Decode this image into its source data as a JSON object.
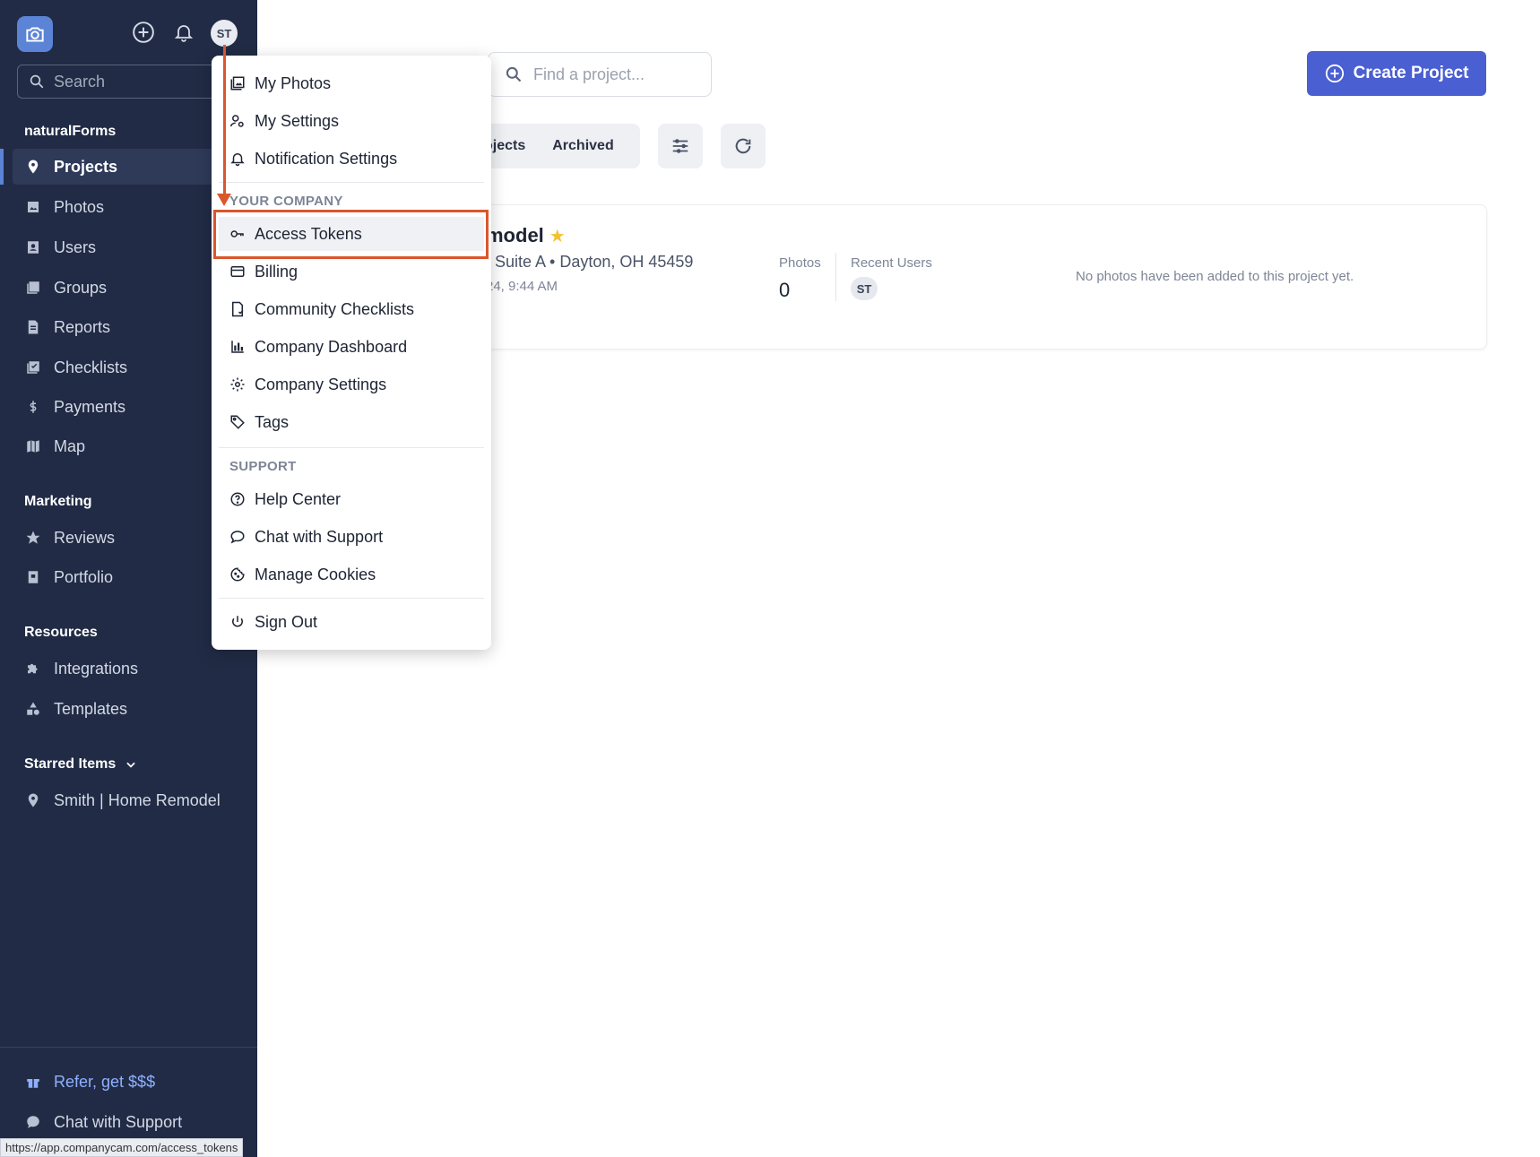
{
  "sidebar": {
    "search_placeholder": "Search",
    "org_name": "naturalForms",
    "avatar_initials": "ST",
    "nav": [
      {
        "label": "Projects",
        "icon": "map-pin-icon"
      },
      {
        "label": "Photos",
        "icon": "image-icon"
      },
      {
        "label": "Users",
        "icon": "user-card-icon"
      },
      {
        "label": "Groups",
        "icon": "groups-icon"
      },
      {
        "label": "Reports",
        "icon": "report-icon"
      },
      {
        "label": "Checklists",
        "icon": "checklist-icon"
      },
      {
        "label": "Payments",
        "icon": "dollar-icon"
      },
      {
        "label": "Map",
        "icon": "map-icon"
      }
    ],
    "marketing_title": "Marketing",
    "marketing": [
      {
        "label": "Reviews",
        "icon": "star-icon"
      },
      {
        "label": "Portfolio",
        "icon": "portfolio-icon"
      }
    ],
    "resources_title": "Resources",
    "resources": [
      {
        "label": "Integrations",
        "icon": "puzzle-icon"
      },
      {
        "label": "Templates",
        "icon": "shapes-icon"
      }
    ],
    "starred_title": "Starred Items",
    "starred": [
      {
        "label": "Smith | Home Remodel",
        "icon": "pin-icon"
      }
    ],
    "refer_label": "Refer, get $$$",
    "chat_label": "Chat with Support"
  },
  "status_url": "https://app.companycam.com/access_tokens",
  "main": {
    "find_placeholder": "Find a project...",
    "create_label": "Create Project",
    "tab_projects": "ojects",
    "tab_archived": "Archived",
    "project": {
      "title": "model",
      "address": ", Suite A • Dayton, OH 45459",
      "date": "24, 9:44 AM",
      "photos_label": "Photos",
      "photos_count": "0",
      "recent_users_label": "Recent Users",
      "recent_user": "ST",
      "empty_text": "No photos have been added to this project yet."
    }
  },
  "menu": {
    "personal": [
      {
        "label": "My Photos",
        "icon": "photos-icon"
      },
      {
        "label": "My Settings",
        "icon": "user-settings-icon"
      },
      {
        "label": "Notification Settings",
        "icon": "bell-icon"
      }
    ],
    "company_title": "YOUR COMPANY",
    "company": [
      {
        "label": "Access Tokens",
        "icon": "key-icon"
      },
      {
        "label": "Billing",
        "icon": "credit-card-icon"
      },
      {
        "label": "Community Checklists",
        "icon": "checklist-doc-icon"
      },
      {
        "label": "Company Dashboard",
        "icon": "bar-chart-icon"
      },
      {
        "label": "Company Settings",
        "icon": "gear-icon"
      },
      {
        "label": "Tags",
        "icon": "tags-icon"
      }
    ],
    "support_title": "SUPPORT",
    "support": [
      {
        "label": "Help Center",
        "icon": "help-icon"
      },
      {
        "label": "Chat with Support",
        "icon": "chat-icon"
      },
      {
        "label": "Manage Cookies",
        "icon": "cookie-icon"
      }
    ],
    "signout_label": "Sign Out"
  },
  "colors": {
    "sidebar_bg": "#212b45",
    "accent": "#4a5fd1",
    "annotation": "#d9572c",
    "star": "#f2c230"
  }
}
